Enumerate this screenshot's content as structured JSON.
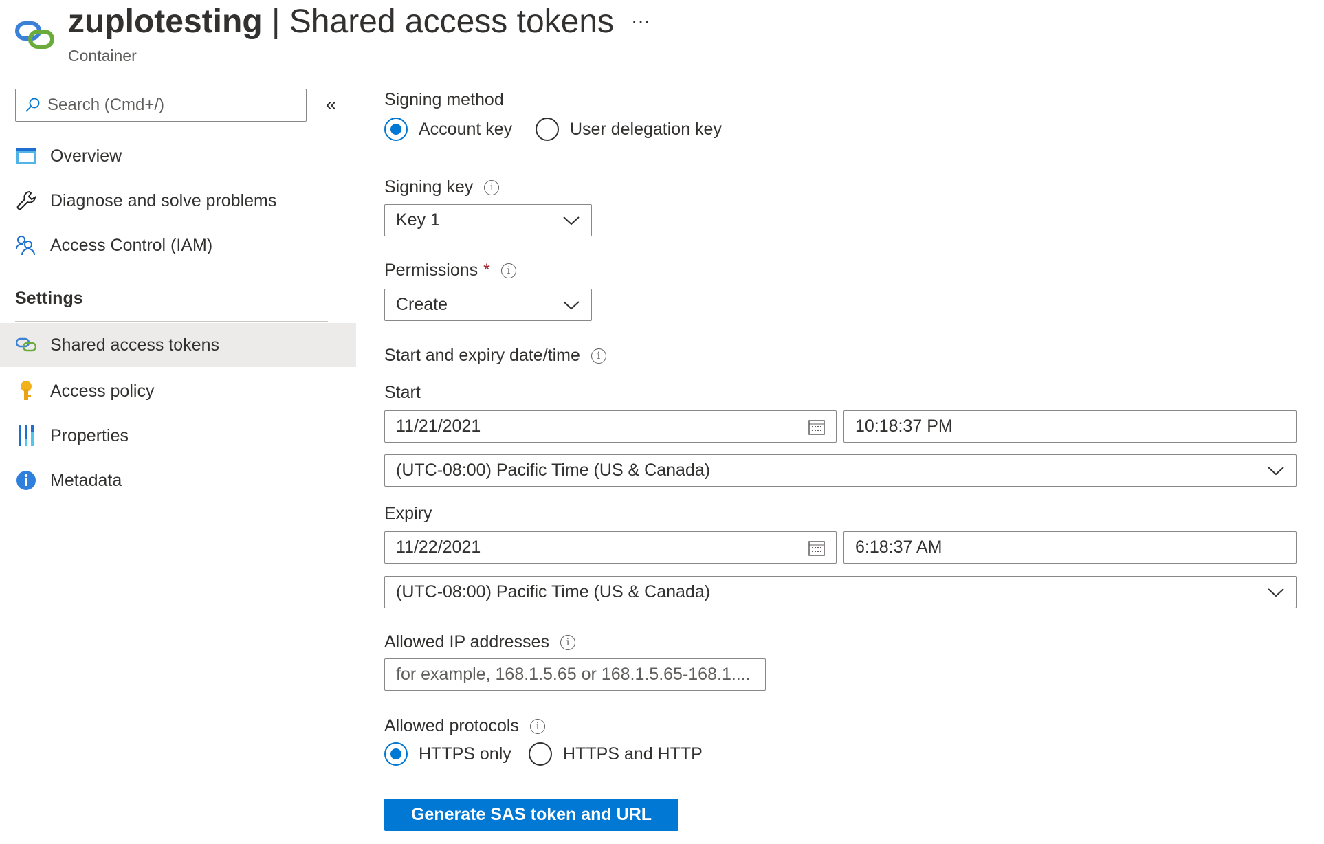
{
  "header": {
    "resource": "zuplotesting",
    "separator": " | ",
    "page": "Shared access tokens",
    "subtitle": "Container",
    "more": "···"
  },
  "sidebar": {
    "search_placeholder": "Search (Cmd+/)",
    "collapse": "«",
    "items": [
      {
        "label": "Overview",
        "icon": "overview-icon"
      },
      {
        "label": "Diagnose and solve problems",
        "icon": "wrench-icon"
      },
      {
        "label": "Access Control (IAM)",
        "icon": "people-icon"
      }
    ],
    "section": "Settings",
    "settings_items": [
      {
        "label": "Shared access tokens",
        "icon": "link-icon",
        "selected": true
      },
      {
        "label": "Access policy",
        "icon": "key-icon"
      },
      {
        "label": "Properties",
        "icon": "properties-icon"
      },
      {
        "label": "Metadata",
        "icon": "info-icon"
      }
    ]
  },
  "form": {
    "signing_method": {
      "label": "Signing method",
      "options": [
        "Account key",
        "User delegation key"
      ],
      "selected": "Account key"
    },
    "signing_key": {
      "label": "Signing key",
      "value": "Key 1"
    },
    "permissions": {
      "label": "Permissions",
      "required": "*",
      "value": "Create"
    },
    "datetime": {
      "label": "Start and expiry date/time"
    },
    "start": {
      "label": "Start",
      "date": "11/21/2021",
      "time": "10:18:37 PM",
      "timezone": "(UTC-08:00) Pacific Time (US & Canada)"
    },
    "expiry": {
      "label": "Expiry",
      "date": "11/22/2021",
      "time": "6:18:37 AM",
      "timezone": "(UTC-08:00) Pacific Time (US & Canada)"
    },
    "ip": {
      "label": "Allowed IP addresses",
      "placeholder": "for example, 168.1.5.65 or 168.1.5.65-168.1...."
    },
    "protocols": {
      "label": "Allowed protocols",
      "options": [
        "HTTPS only",
        "HTTPS and HTTP"
      ],
      "selected": "HTTPS only"
    },
    "generate": "Generate SAS token and URL"
  },
  "colors": {
    "accent": "#0078d4",
    "selected_bg": "#edebe9"
  }
}
